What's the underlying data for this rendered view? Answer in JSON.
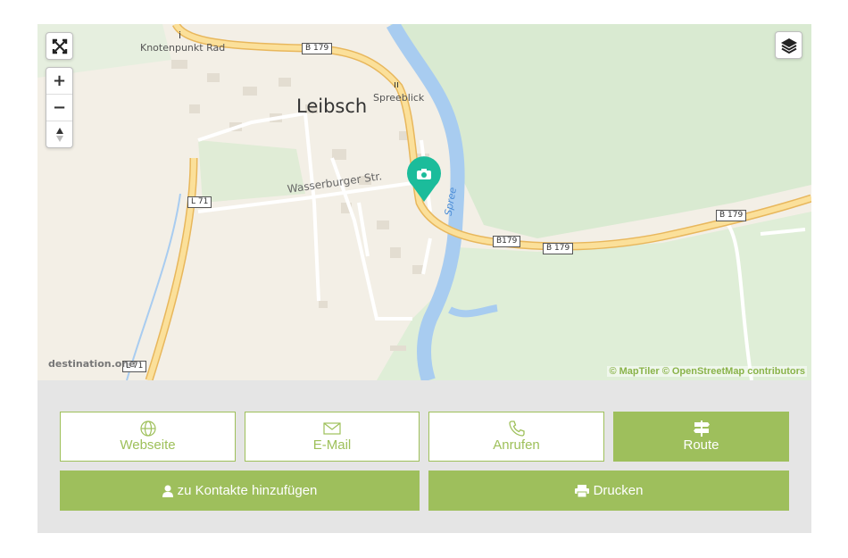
{
  "map": {
    "place_name": "Leibsch",
    "pois": [
      {
        "name": "Knotenpunkt Rad",
        "icon": "info-icon"
      },
      {
        "name": "Spreeblick",
        "icon": "restaurant-icon"
      }
    ],
    "street_label": "Wasserburger Str.",
    "river_label": "Spree",
    "road_shields": [
      "B 179",
      "B179",
      "B 179",
      "B 179",
      "L 71",
      "L 71"
    ],
    "attribution": "© MapTiler © OpenStreetMap contributors",
    "watermark": "destination.one",
    "marker_icon": "camera-icon",
    "marker_color": "#1bbc9b",
    "controls": {
      "fullscreen": "fullscreen-icon",
      "zoom_in": "+",
      "zoom_out": "−",
      "compass": "compass-icon",
      "layers": "layers-icon"
    },
    "colors": {
      "land": "#f3efe6",
      "green": "#d9ead1",
      "water": "#a8ccf0",
      "road": "#fbe09a"
    }
  },
  "actions": {
    "website": {
      "label": "Webseite",
      "icon": "globe-icon"
    },
    "email": {
      "label": "E-Mail",
      "icon": "envelope-icon"
    },
    "call": {
      "label": "Anrufen",
      "icon": "phone-icon"
    },
    "route": {
      "label": "Route",
      "icon": "signpost-icon"
    },
    "add_contact": {
      "label": "zu Kontakte hinzufügen",
      "icon": "user-icon"
    },
    "print": {
      "label": "Drucken",
      "icon": "print-icon"
    }
  },
  "accent_color": "#9ebf5c"
}
